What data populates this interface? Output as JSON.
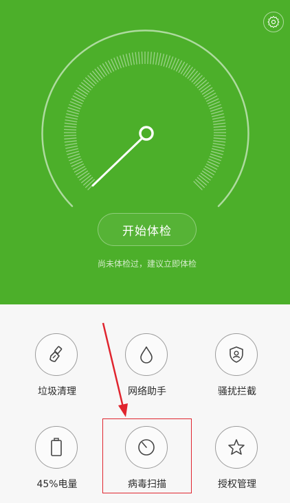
{
  "header": {
    "start_button_label": "开始体检",
    "hint_text": "尚未体检过，建议立即体检"
  },
  "tools": [
    {
      "label": "垃圾清理",
      "icon": "broom-icon"
    },
    {
      "label": "网络助手",
      "icon": "water-drop-icon"
    },
    {
      "label": "骚扰拦截",
      "icon": "shield-user-icon"
    },
    {
      "label": "45%电量",
      "icon": "battery-icon"
    },
    {
      "label": "病毒扫描",
      "icon": "scan-dial-icon"
    },
    {
      "label": "授权管理",
      "icon": "star-icon"
    }
  ],
  "colors": {
    "hero_green": "#4caf2a",
    "highlight_red": "#e0242e"
  }
}
